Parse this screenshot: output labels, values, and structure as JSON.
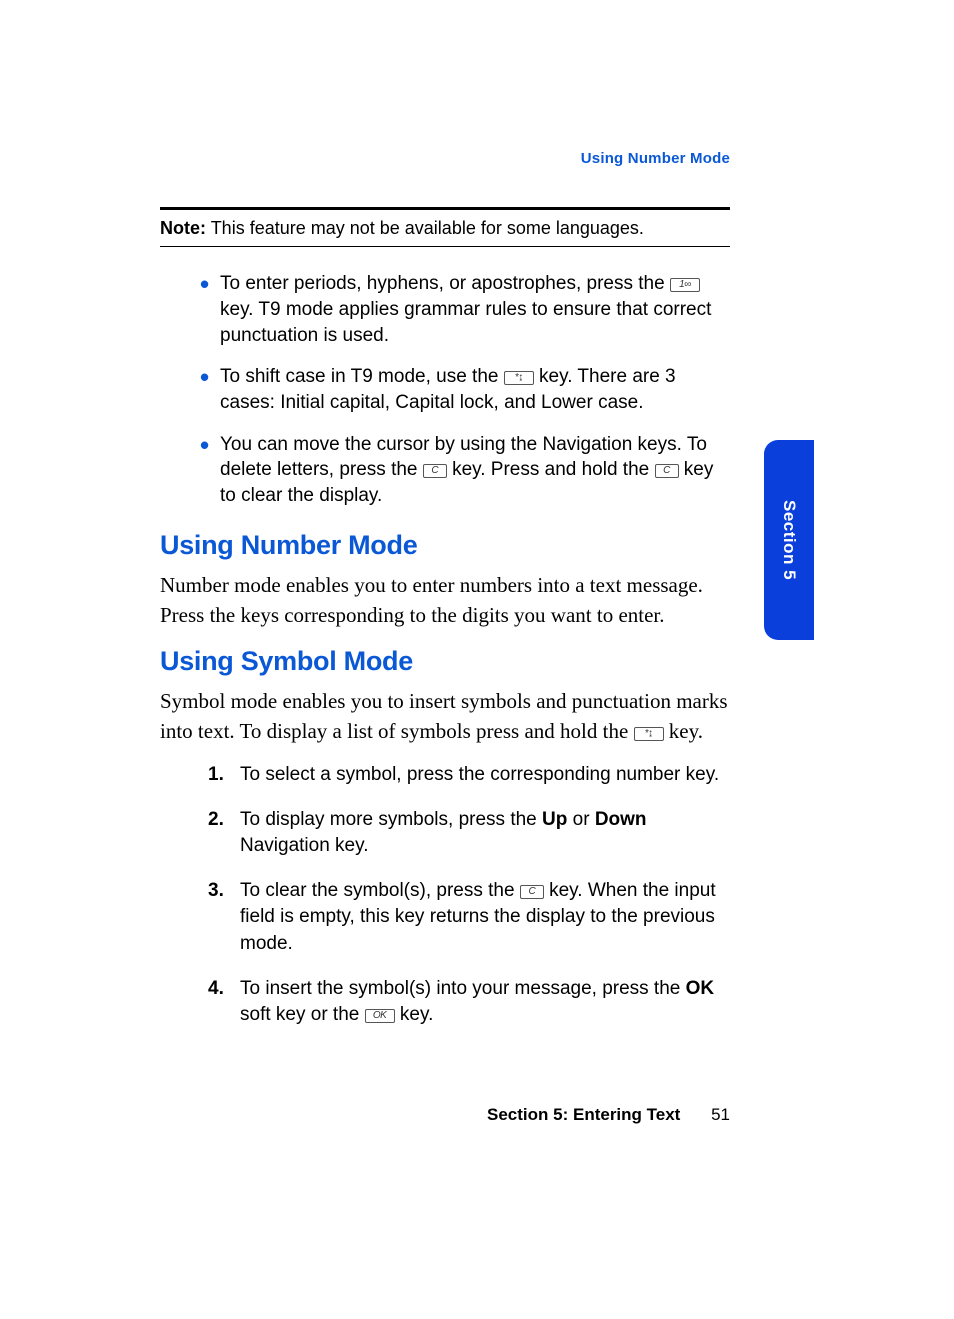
{
  "header": {
    "topic_link": "Using Number Mode"
  },
  "note": {
    "label": "Note:",
    "text": "This feature may not be available for some languages."
  },
  "bullets": [
    {
      "pre": "To enter periods, hyphens, or apostrophes, press the ",
      "key": "1∞",
      "post": " key. T9 mode applies grammar rules to ensure that correct punctuation is used."
    },
    {
      "pre": "To shift case in T9 mode, use the ",
      "key": "*↨",
      "post": " key. There are 3 cases: Initial capital, Capital lock, and Lower case."
    },
    {
      "pre": "You can move the cursor by using the Navigation keys. To delete letters, press the ",
      "key": "C",
      "mid": " key. Press and hold the ",
      "key2": "C",
      "post": " key to clear the display."
    }
  ],
  "sections": {
    "number": {
      "heading": "Using Number Mode",
      "body": "Number mode enables you to enter numbers into a text message. Press the keys corresponding to the digits you want to enter."
    },
    "symbol": {
      "heading": "Using Symbol Mode",
      "body_pre": "Symbol mode enables you to insert symbols and punctuation marks into text. To display a list of symbols press and hold the ",
      "body_key": "*↨",
      "body_post": " key."
    }
  },
  "steps": [
    {
      "text": "To select a symbol, press the corresponding number key."
    },
    {
      "pre": "To display more symbols, press the ",
      "b1": "Up",
      "mid": " or ",
      "b2": "Down",
      "post": " Navigation key."
    },
    {
      "pre": "To clear the symbol(s), press the ",
      "key": "C",
      "post": " key. When the input field is empty, this key returns the display to the previous mode."
    },
    {
      "pre": "To insert the symbol(s) into your message, press the ",
      "b1": "OK",
      "mid": " soft key or the ",
      "key": "OK",
      "post": " key."
    }
  ],
  "tab": {
    "label": "Section 5"
  },
  "footer": {
    "section": "Section 5: Entering Text",
    "page": "51"
  }
}
